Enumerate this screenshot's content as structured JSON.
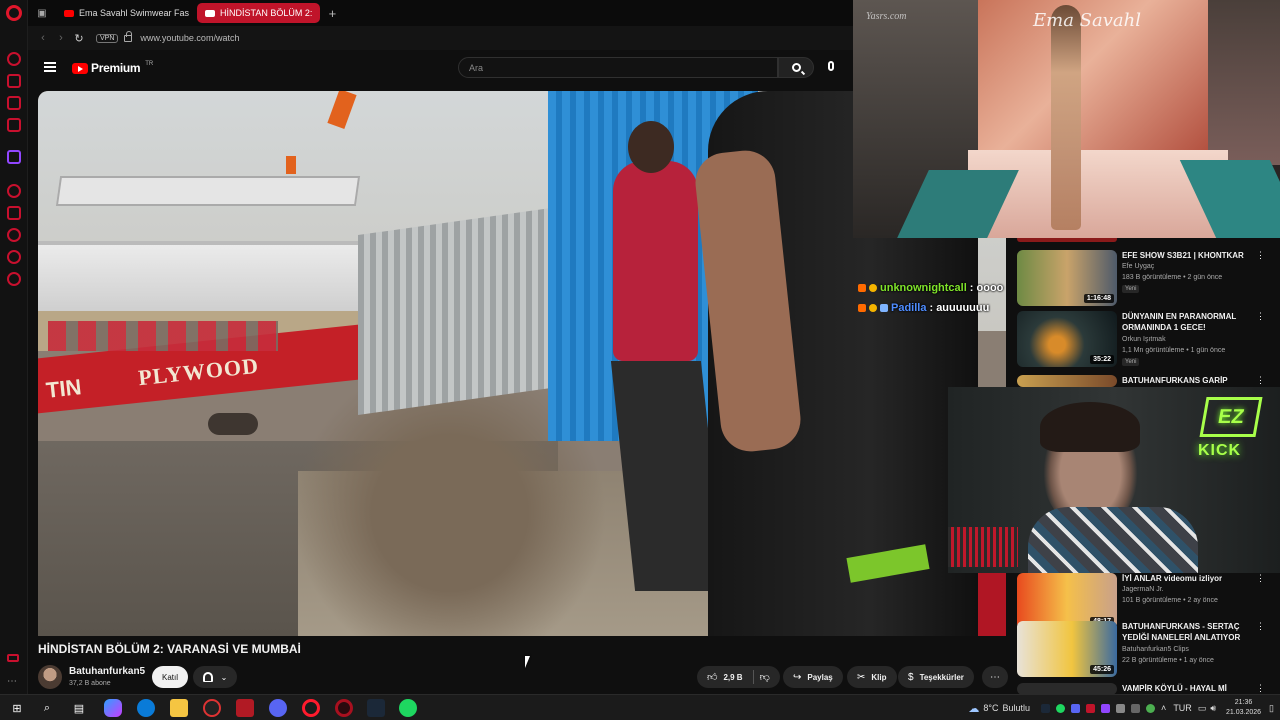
{
  "browser": {
    "tabs": [
      {
        "label": "Ema Savahl Swimwear Fas",
        "active": false
      },
      {
        "label": "HİNDİSTAN BÖLÜM 2:",
        "active": true
      }
    ],
    "vpn_label": "VPN",
    "url": "www.youtube.com/watch",
    "accent_color": "#c0142a"
  },
  "youtube": {
    "logo_text": "Premium",
    "region": "TR",
    "search_placeholder": "Ara",
    "video": {
      "title": "HİNDİSTAN BÖLÜM 2: VARANASİ VE MUMBAİ",
      "boat_text": "PLYWOOD",
      "boat_text2": "TIN",
      "channel_name": "Batuhanfurkan5",
      "subscribers": "37,2 B abone",
      "join_label": "Katıl",
      "likes": "2,9 B",
      "share_label": "Paylaş",
      "clip_label": "Klip",
      "thanks_label": "Teşekkürler"
    },
    "recommendations": [
      {
        "title": "EFE SHOW S3B21 | KHONTKAR",
        "channel": "Efe Uygaç",
        "meta": "183 B görüntüleme • 2 gün önce",
        "badge": "Yeni",
        "duration": "1:16:48"
      },
      {
        "title": "DÜNYANIN EN PARANORMAL ORMANINDA 1 GECE!",
        "channel": "Orkun Işıtmak",
        "meta": "1,1 Mn görüntüleme • 1 gün önce",
        "badge": "Yeni",
        "duration": "35:22"
      },
      {
        "title": "BATUHANFURKANS GARİP",
        "channel": "",
        "meta": "",
        "badge": "",
        "duration": ""
      },
      {
        "title": "İYİ ANLAR videomu izliyor",
        "channel": "JagermaN Jr.",
        "meta": "101 B görüntüleme • 2 ay önce",
        "badge": "",
        "duration": "48:17"
      },
      {
        "title": "BATUHANFURKANS - SERTAÇ YEDİĞİ NANELERİ ANLATIYOR",
        "channel": "Batuhanfurkan5 Clips",
        "meta": "22 B görüntüleme • 1 ay önce",
        "badge": "",
        "duration": "45:26"
      },
      {
        "title": "VAMPİR KÖYLÜ - HAYAL Mİ",
        "channel": "",
        "meta": "",
        "badge": "",
        "duration": ""
      }
    ]
  },
  "pip": {
    "watermark": "Yasrs.com",
    "brand": "Ema Savahl"
  },
  "chat": [
    {
      "user": "unknownightcall",
      "message": ": oooo",
      "badge_colors": [
        "#ff6a00",
        "#f5b400"
      ]
    },
    {
      "user": "Padilla",
      "message": ": auuuuuuu",
      "badge_colors": [
        "#ff6a00",
        "#f5b400",
        "#7fb4ff"
      ]
    }
  ],
  "webcam": {
    "logo": "EZ",
    "brand": "KICK"
  },
  "taskbar": {
    "weather_temp": "8°C",
    "weather_label": "Bulutlu",
    "language": "TUR",
    "time": "21:36",
    "date": "21.03.2026"
  }
}
